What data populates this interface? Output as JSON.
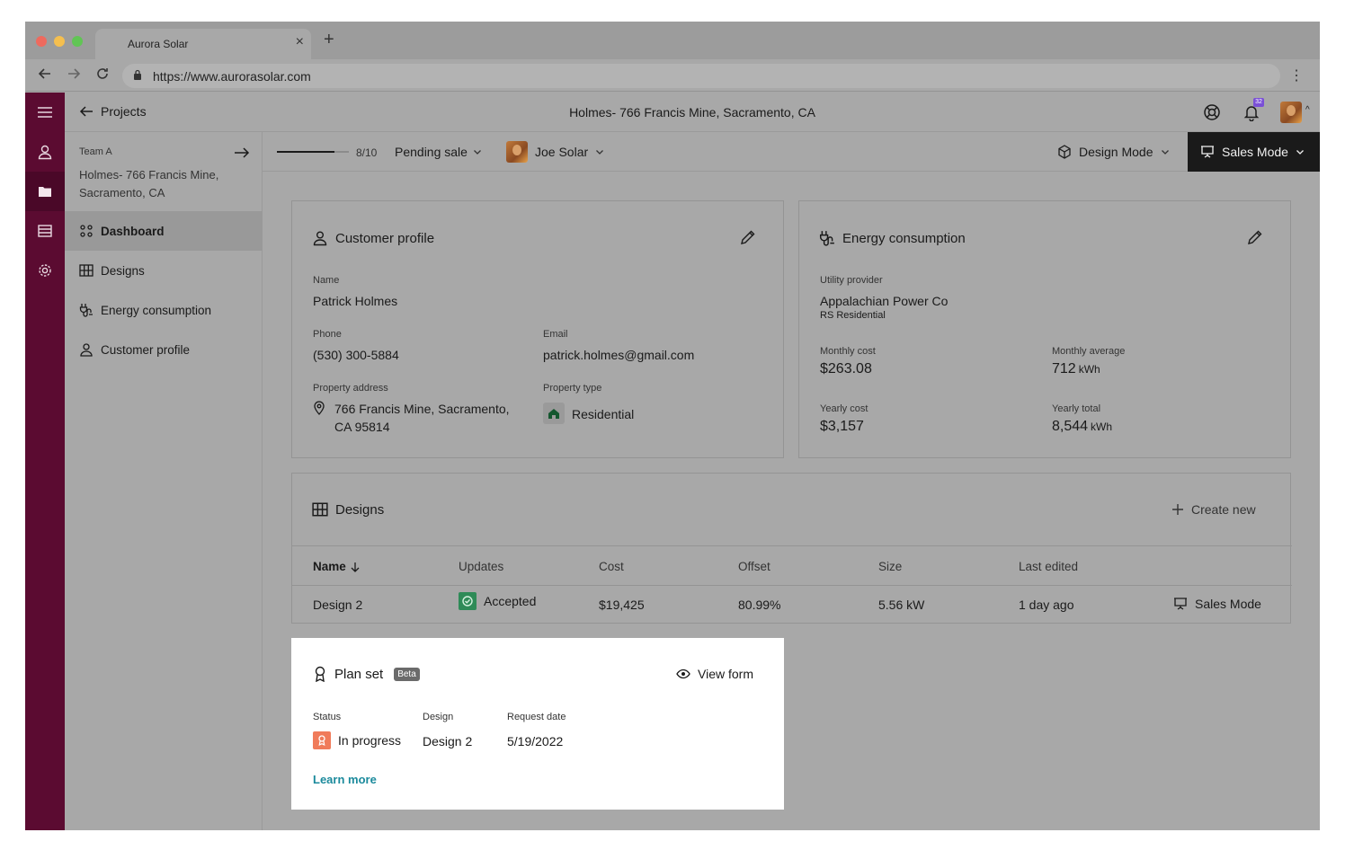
{
  "browser": {
    "tab_title": "Aurora Solar",
    "url": "https://www.aurorasolar.com"
  },
  "topbar": {
    "back_label": "Projects",
    "page_title": "Holmes- 766 Francis Mine, Sacramento, CA",
    "notification_count": "32"
  },
  "sidebar": {
    "team": "Team A",
    "project_name": "Holmes- 766 Francis Mine, Sacramento, CA",
    "items": [
      {
        "label": "Dashboard"
      },
      {
        "label": "Designs"
      },
      {
        "label": "Energy consumption"
      },
      {
        "label": "Customer profile"
      }
    ]
  },
  "subbar": {
    "progress": 0.8,
    "progress_text": "8/10",
    "status": "Pending sale",
    "owner": "Joe Solar",
    "design_mode": "Design Mode",
    "sales_mode": "Sales Mode"
  },
  "customer_profile": {
    "title": "Customer profile",
    "name_label": "Name",
    "name": "Patrick Holmes",
    "phone_label": "Phone",
    "phone": "(530) 300-5884",
    "email_label": "Email",
    "email": "patrick.holmes@gmail.com",
    "address_label": "Property address",
    "address_line1": "766 Francis Mine, Sacramento,",
    "address_line2": "CA 95814",
    "type_label": "Property type",
    "type": "Residential"
  },
  "energy": {
    "title": "Energy consumption",
    "provider_label": "Utility provider",
    "provider": "Appalachian Power Co",
    "rate": "RS Residential",
    "monthly_cost_label": "Monthly cost",
    "monthly_cost": "$263.08",
    "monthly_avg_label": "Monthly average",
    "monthly_avg": "712",
    "monthly_avg_unit": "kWh",
    "yearly_cost_label": "Yearly cost",
    "yearly_cost": "$3,157",
    "yearly_total_label": "Yearly total",
    "yearly_total": "8,544",
    "yearly_total_unit": "kWh"
  },
  "designs": {
    "title": "Designs",
    "create_new": "Create new",
    "columns": [
      "Name",
      "Updates",
      "Cost",
      "Offset",
      "Size",
      "Last edited"
    ],
    "rows": [
      {
        "name": "Design 2",
        "update": "Accepted",
        "cost": "$19,425",
        "offset": "80.99%",
        "size": "5.56 kW",
        "last_edited": "1 day ago",
        "action": "Sales Mode"
      }
    ]
  },
  "plan_set": {
    "title": "Plan set",
    "badge": "Beta",
    "view_form": "View form",
    "status_label": "Status",
    "status": "In progress",
    "design_label": "Design",
    "design": "Design 2",
    "date_label": "Request date",
    "date": "5/19/2022",
    "learn_more": "Learn more"
  },
  "colors": {
    "rail": "#5b0b31",
    "accent_link": "#1b8a9c",
    "accepted": "#2e8b57",
    "in_progress": "#f07b5a"
  }
}
